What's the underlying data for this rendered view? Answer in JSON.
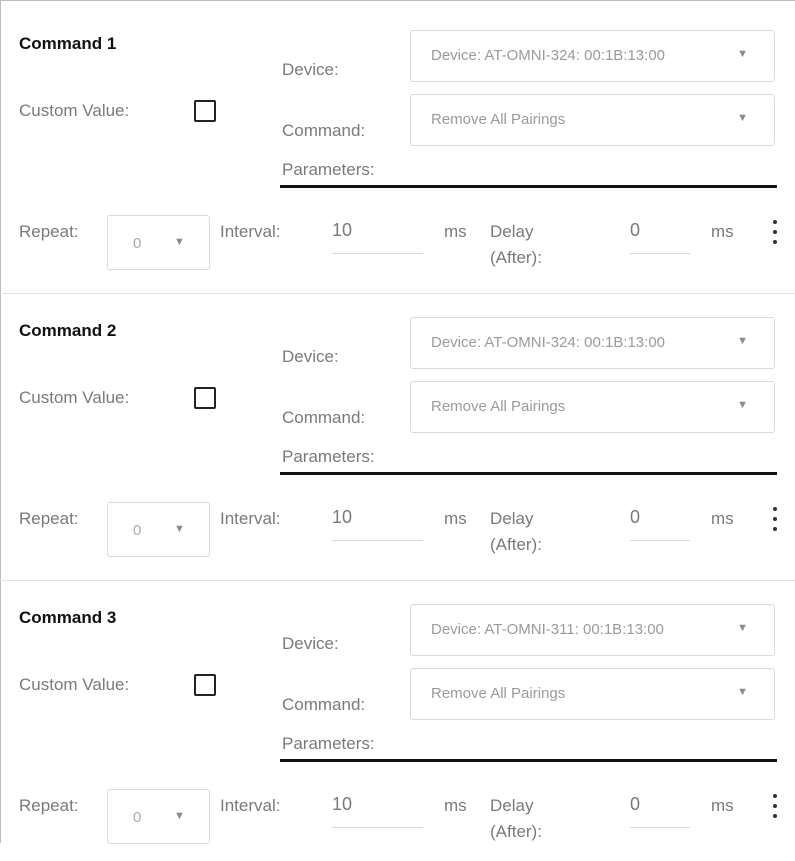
{
  "labels": {
    "custom_value": "Custom Value:",
    "device": "Device:",
    "command": "Command:",
    "parameters": "Parameters:",
    "repeat": "Repeat:",
    "interval": "Interval:",
    "ms": "ms",
    "delay": "Delay",
    "after": "(After):"
  },
  "commands": [
    {
      "title": "Command 1",
      "device": "Device: AT-OMNI-324: 00:1B:13:00",
      "command": "Remove All Pairings",
      "custom_value_checked": false,
      "repeat": "0",
      "interval": "10",
      "delay": "0"
    },
    {
      "title": "Command 2",
      "device": "Device: AT-OMNI-324: 00:1B:13:00",
      "command": "Remove All Pairings",
      "custom_value_checked": false,
      "repeat": "0",
      "interval": "10",
      "delay": "0"
    },
    {
      "title": "Command 3",
      "device": "Device: AT-OMNI-311: 00:1B:13:00",
      "command": "Remove All Pairings",
      "custom_value_checked": false,
      "repeat": "0",
      "interval": "10",
      "delay": "0"
    }
  ],
  "icons": {
    "dropdown": "caret-down-icon",
    "menu": "more-vertical-icon"
  }
}
